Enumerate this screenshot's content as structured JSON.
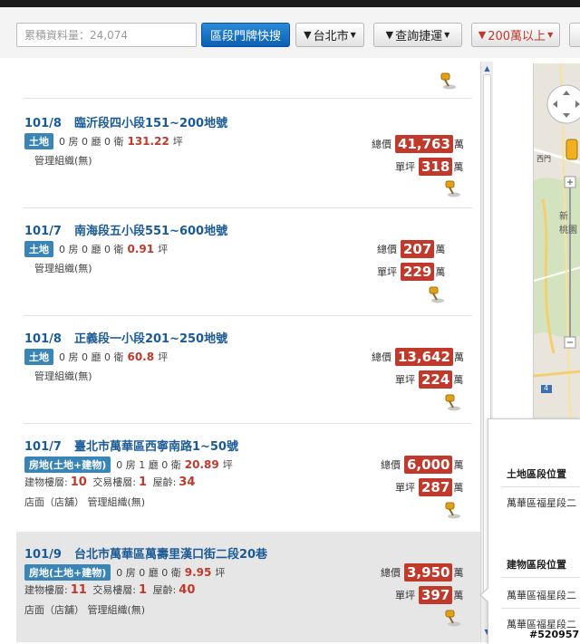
{
  "toolbar": {
    "search_placeholder": "累積資料量：24,074",
    "section_button": "區段門牌快搜",
    "filters": [
      {
        "label": "台北市"
      },
      {
        "label": "查詢捷運"
      },
      {
        "label": "200萬以上"
      }
    ]
  },
  "top_partial_pin": "location-pin-icon",
  "listings": [
    {
      "date": "101/8",
      "title": "臨沂段四小段151~200地號",
      "type_badge": "土地",
      "rooms": "0 房 0 廳 0 衛",
      "area": "131.22",
      "area_unit": "坪",
      "mgmt": "管理組織(無)",
      "total_label": "總價",
      "total": "41,763",
      "total_unit": "萬",
      "unit_label": "單坪",
      "unit_price": "318",
      "unit_unit": "萬"
    },
    {
      "date": "101/7",
      "title": "南海段五小段551~600地號",
      "type_badge": "土地",
      "rooms": "0 房 0 廳 0 衛",
      "area": "0.91",
      "area_unit": "坪",
      "mgmt": "管理組織(無)",
      "total_label": "總價",
      "total": "207",
      "total_unit": "萬",
      "unit_label": "單坪",
      "unit_price": "229",
      "unit_unit": "萬"
    },
    {
      "date": "101/8",
      "title": "正義段一小段201~250地號",
      "type_badge": "土地",
      "rooms": "0 房 0 廳 0 衛",
      "area": "60.8",
      "area_unit": "坪",
      "mgmt": "管理組織(無)",
      "total_label": "總價",
      "total": "13,642",
      "total_unit": "萬",
      "unit_label": "單坪",
      "unit_price": "224",
      "unit_unit": "萬"
    },
    {
      "date": "101/7",
      "title": "臺北市萬華區西寧南路1~50號",
      "type_badge": "房地(土地+建物)",
      "rooms": "0 房 1 廳 0 衛",
      "area": "20.89",
      "area_unit": "坪",
      "floors_label": "建物樓層:",
      "floors": "10",
      "trade_label": "交易樓層:",
      "trade_floor": "1",
      "age_label": "屋齡:",
      "age": "34",
      "mgmt": "店面（店舖） 管理組織(無)",
      "total_label": "總價",
      "total": "6,000",
      "total_unit": "萬",
      "unit_label": "單坪",
      "unit_price": "287",
      "unit_unit": "萬"
    },
    {
      "date": "101/9",
      "title": "台北市萬華區萬壽里漢口街二段20巷",
      "type_badge": "房地(土地+建物)",
      "rooms": "0 房 0 廳 0 衛",
      "area": "9.95",
      "area_unit": "坪",
      "floors_label": "建物樓層:",
      "floors": "11",
      "trade_label": "交易樓層:",
      "trade_floor": "1",
      "age_label": "屋齡:",
      "age": "40",
      "mgmt": "店面（店舖） 管理組織(無)",
      "total_label": "總價",
      "total": "3,950",
      "total_unit": "萬",
      "unit_label": "單坪",
      "unit_price": "397",
      "unit_unit": "萬"
    }
  ],
  "side_panel": {
    "land_heading": "土地區段位置",
    "land_value": "萬華區福星段二",
    "building_heading": "建物區段位置",
    "building_values": [
      "萬華區福星段二",
      "萬華區福星段二"
    ]
  },
  "map": {
    "label_west_gate": "西門",
    "label_xinhai": "新",
    "label_taoyuan": "桃園",
    "road_number": "4"
  },
  "watermark": "#520957",
  "colors": {
    "accent_blue": "#1a5a96",
    "price_red": "#c0392b",
    "badge_blue": "#3a85b8",
    "primary_button": "#0a5fb4"
  }
}
